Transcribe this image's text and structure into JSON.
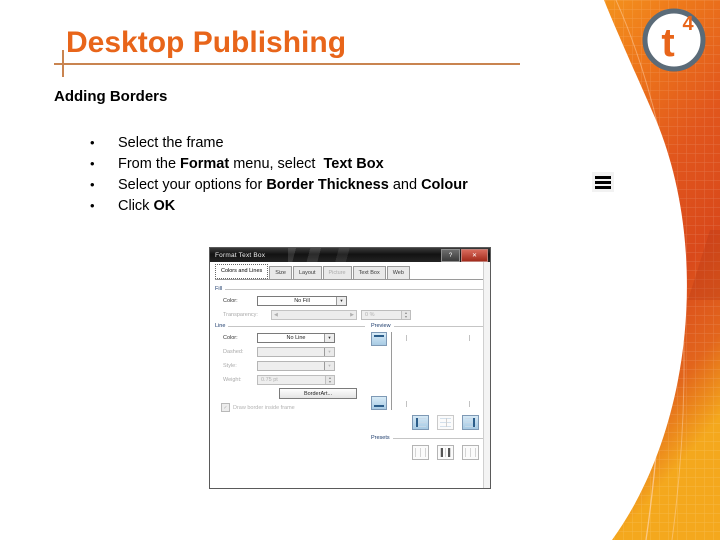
{
  "slide": {
    "title": "Desktop Publishing",
    "heading": "Adding Borders",
    "accent_color": "#E8651A",
    "rule_color": "#C98450"
  },
  "bullets": [
    {
      "marker": "•",
      "text": "Select the frame"
    },
    {
      "marker": "•",
      "text": "From the Format menu, select  Text Box"
    },
    {
      "marker": "•",
      "text": "Select your options for Border Thickness and Colour"
    },
    {
      "marker": "•",
      "text": "Click OK"
    }
  ],
  "logo": {
    "name": "t4-logo",
    "letter": "t",
    "superscript": "4"
  },
  "list_icon": {
    "name": "list-lines-icon"
  },
  "dialog": {
    "title": "Format Text Box",
    "help_button": "?",
    "close_button": "✕",
    "tabs": [
      {
        "label": "Colors and Lines",
        "state": "active"
      },
      {
        "label": "Size",
        "state": "normal"
      },
      {
        "label": "Layout",
        "state": "normal"
      },
      {
        "label": "Picture",
        "state": "disabled"
      },
      {
        "label": "Text Box",
        "state": "normal"
      },
      {
        "label": "Web",
        "state": "normal"
      }
    ],
    "fill": {
      "group_label": "Fill",
      "color_label": "Color:",
      "color_value": "No Fill",
      "transparency_label": "Transparency:",
      "transparency_value": "0 %",
      "slider_left": "◀",
      "slider_right": "▶"
    },
    "line": {
      "group_label": "Line",
      "color_label": "Color:",
      "color_value": "No Line",
      "dashed_label": "Dashed:",
      "dashed_value": "",
      "style_label": "Style:",
      "style_value": "",
      "weight_label": "Weight:",
      "weight_value": "0.75 pt",
      "borderart_button": "BorderArt...",
      "draw_border_checkbox_label": "Draw border inside frame",
      "draw_border_checked": true
    },
    "preview": {
      "group_label": "Preview",
      "top_button": "preview-top-border",
      "bottom_button": "preview-bottom-border",
      "side_buttons": [
        "left-border",
        "none-border",
        "right-border"
      ]
    },
    "presets": {
      "group_label": "Presets",
      "buttons": [
        "preset-none",
        "preset-box",
        "preset-grid"
      ]
    }
  }
}
